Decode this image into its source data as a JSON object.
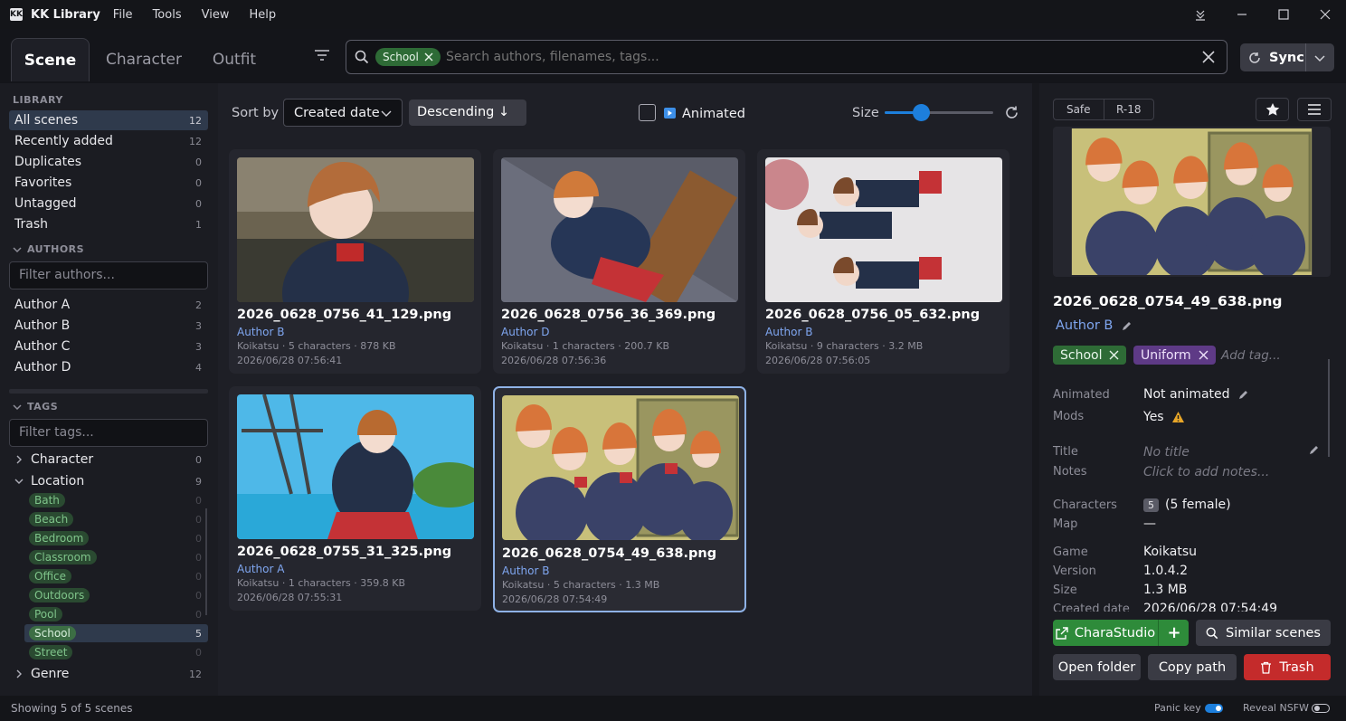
{
  "app": {
    "title": "KK Library",
    "menu": [
      "File",
      "Tools",
      "View",
      "Help"
    ]
  },
  "tabs": [
    "Scene",
    "Character",
    "Outfit"
  ],
  "search": {
    "chip": "School",
    "placeholder": "Search authors, filenames, tags..."
  },
  "sync": {
    "label": "Sync"
  },
  "sidebar": {
    "library_header": "LIBRARY",
    "library": [
      {
        "label": "All scenes",
        "count": "12"
      },
      {
        "label": "Recently added",
        "count": "12"
      },
      {
        "label": "Duplicates",
        "count": "0"
      },
      {
        "label": "Favorites",
        "count": "0"
      },
      {
        "label": "Untagged",
        "count": "0"
      },
      {
        "label": "Trash",
        "count": "1"
      }
    ],
    "authors_header": "AUTHORS",
    "authors_placeholder": "Filter authors...",
    "authors": [
      {
        "label": "Author A",
        "count": "2"
      },
      {
        "label": "Author B",
        "count": "3"
      },
      {
        "label": "Author C",
        "count": "3"
      },
      {
        "label": "Author D",
        "count": "4"
      }
    ],
    "tags_header": "TAGS",
    "tags_placeholder": "Filter tags...",
    "tag_groups": [
      {
        "label": "Character",
        "count": "0"
      },
      {
        "label": "Location",
        "count": "9"
      }
    ],
    "location_tags": [
      {
        "label": "Bath",
        "count": "0"
      },
      {
        "label": "Beach",
        "count": "0"
      },
      {
        "label": "Bedroom",
        "count": "0"
      },
      {
        "label": "Classroom",
        "count": "0"
      },
      {
        "label": "Office",
        "count": "0"
      },
      {
        "label": "Outdoors",
        "count": "0"
      },
      {
        "label": "Pool",
        "count": "0"
      },
      {
        "label": "School",
        "count": "5"
      },
      {
        "label": "Street",
        "count": "0"
      }
    ],
    "genre": {
      "label": "Genre",
      "count": "12"
    }
  },
  "toolbar": {
    "sort_label": "Sort by",
    "sort_value": "Created date",
    "order_value": "Descending ↓",
    "animated_label": "Animated",
    "size_label": "Size",
    "size_value": 0.34
  },
  "cards": [
    {
      "name": "2026_0628_0756_41_129.png",
      "author": "Author B",
      "meta": "Koikatsu · 5 characters · 878 KB",
      "date": "2026/06/28 07:56:41"
    },
    {
      "name": "2026_0628_0756_36_369.png",
      "author": "Author D",
      "meta": "Koikatsu · 1 characters · 200.7 KB",
      "date": "2026/06/28 07:56:36"
    },
    {
      "name": "2026_0628_0756_05_632.png",
      "author": "Author B",
      "meta": "Koikatsu · 9 characters · 3.2 MB",
      "date": "2026/06/28 07:56:05"
    },
    {
      "name": "2026_0628_0755_31_325.png",
      "author": "Author A",
      "meta": "Koikatsu · 1 characters · 359.8 KB",
      "date": "2026/06/28 07:55:31"
    },
    {
      "name": "2026_0628_0754_49_638.png",
      "author": "Author B",
      "meta": "Koikatsu · 5 characters · 1.3 MB",
      "date": "2026/06/28 07:54:49"
    }
  ],
  "detail": {
    "safe_label": "Safe",
    "r18_label": "R-18",
    "filename": "2026_0628_0754_49_638.png",
    "author": "Author B",
    "tags": [
      "School",
      "Uniform"
    ],
    "add_tag_placeholder": "Add tag...",
    "animated_label": "Animated",
    "animated_value": "Not animated",
    "mods_label": "Mods",
    "mods_value": "Yes",
    "title_label": "Title",
    "title_value": "No title",
    "notes_label": "Notes",
    "notes_value": "Click to add notes...",
    "characters_label": "Characters",
    "characters_count": "5",
    "characters_value": "(5 female)",
    "map_label": "Map",
    "map_value": "—",
    "game_label": "Game",
    "game_value": "Koikatsu",
    "version_label": "Version",
    "version_value": "1.0.4.2",
    "size_label": "Size",
    "size_value": "1.3 MB",
    "created_label": "Created date",
    "created_value": "2026/06/28 07:54:49",
    "charastudio_label": "CharaStudio",
    "similar_label": "Similar scenes",
    "open_folder_label": "Open folder",
    "copy_path_label": "Copy path",
    "trash_label": "Trash"
  },
  "status": {
    "text": "Showing 5 of 5 scenes",
    "panic_label": "Panic key",
    "panic_on": true,
    "nsfw_label": "Reveal NSFW",
    "nsfw_on": false
  },
  "colors": {
    "accent": "#1d7fdc",
    "green": "#2e8b3a",
    "danger": "#c42b2b",
    "purple": "#5e3a86"
  }
}
